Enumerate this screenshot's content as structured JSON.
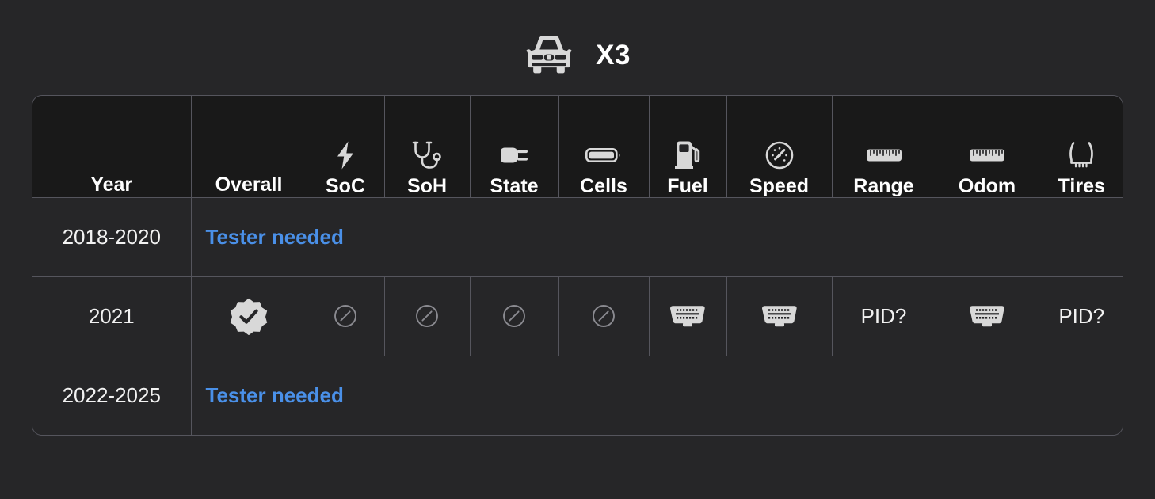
{
  "header": {
    "vehicle_icon": "car-front-icon",
    "title": "X3"
  },
  "table": {
    "columns": [
      {
        "key": "year",
        "label": "Year",
        "icon": null
      },
      {
        "key": "overall",
        "label": "Overall",
        "icon": null
      },
      {
        "key": "soc",
        "label": "SoC",
        "icon": "lightning-bolt-icon"
      },
      {
        "key": "soh",
        "label": "SoH",
        "icon": "stethoscope-icon"
      },
      {
        "key": "state",
        "label": "State",
        "icon": "power-plug-icon"
      },
      {
        "key": "cells",
        "label": "Cells",
        "icon": "battery-icon"
      },
      {
        "key": "fuel",
        "label": "Fuel",
        "icon": "fuel-pump-icon"
      },
      {
        "key": "speed",
        "label": "Speed",
        "icon": "speedometer-icon"
      },
      {
        "key": "range",
        "label": "Range",
        "icon": "ruler-icon"
      },
      {
        "key": "odom",
        "label": "Odom",
        "icon": "ruler-icon"
      },
      {
        "key": "tires",
        "label": "Tires",
        "icon": "tire-pressure-icon"
      }
    ],
    "rows": [
      {
        "year": "2018-2020",
        "type": "tester-needed",
        "message": "Tester needed"
      },
      {
        "year": "2021",
        "type": "data",
        "cells": [
          {
            "column": "overall",
            "kind": "icon",
            "icon": "verified-badge-icon",
            "value": ""
          },
          {
            "column": "soc",
            "kind": "icon",
            "icon": "not-supported-icon",
            "value": ""
          },
          {
            "column": "soh",
            "kind": "icon",
            "icon": "not-supported-icon",
            "value": ""
          },
          {
            "column": "state",
            "kind": "icon",
            "icon": "not-supported-icon",
            "value": ""
          },
          {
            "column": "cells",
            "kind": "icon",
            "icon": "not-supported-icon",
            "value": ""
          },
          {
            "column": "fuel",
            "kind": "icon",
            "icon": "obd-connector-icon",
            "value": ""
          },
          {
            "column": "speed",
            "kind": "icon",
            "icon": "obd-connector-icon",
            "value": ""
          },
          {
            "column": "range",
            "kind": "text",
            "icon": null,
            "value": "PID?"
          },
          {
            "column": "odom",
            "kind": "icon",
            "icon": "obd-connector-icon",
            "value": ""
          },
          {
            "column": "tires",
            "kind": "text",
            "icon": null,
            "value": "PID?"
          }
        ]
      },
      {
        "year": "2022-2025",
        "type": "tester-needed",
        "message": "Tester needed"
      }
    ]
  },
  "colors": {
    "page_background": "#262628",
    "header_cell_background": "#191919",
    "border": "#55555d",
    "link_blue": "#4a90e8",
    "icon_light": "#d8d8d8",
    "icon_muted": "#8a8a90",
    "text": "#f2f2f2"
  }
}
